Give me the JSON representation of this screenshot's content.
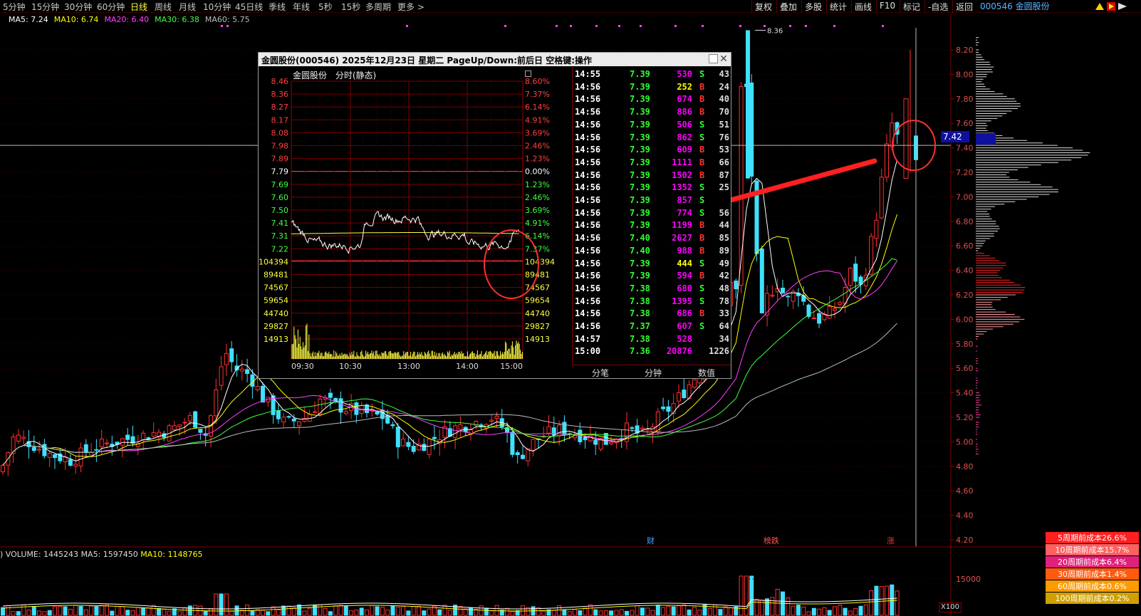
{
  "stock": {
    "code": "000546",
    "name": "金圆股份"
  },
  "periods": [
    "5分钟",
    "15分钟",
    "30分钟",
    "60分钟",
    "日线",
    "周线",
    "月线",
    "10分钟",
    "45日线",
    "季线",
    "年线",
    "5秒",
    "15秒",
    "多周期",
    "更多 >"
  ],
  "active_period": "日线",
  "right_tools": [
    "复权",
    "叠加",
    "多股",
    "统计",
    "画线",
    "F10",
    "标记",
    "-自选",
    "返回"
  ],
  "ma_header": {
    "ma5": "MA5: 7.24",
    "ma10": "MA10: 6.74",
    "ma20": "MA20: 6.40",
    "ma30": "MA30: 6.38",
    "ma60": "MA60: 5.75"
  },
  "price_axis": [
    "8.20",
    "8.00",
    "7.80",
    "7.60",
    "7.40",
    "7.20",
    "7.00",
    "6.80",
    "6.60",
    "6.40",
    "6.20",
    "6.00",
    "5.80",
    "5.60",
    "5.40",
    "5.20",
    "5.00",
    "4.80",
    "4.60",
    "4.40",
    "4.20"
  ],
  "high_label": "8.36",
  "current_price": "7.42",
  "event_markers": [
    {
      "text": "财",
      "color": "#4aa8ff"
    },
    {
      "text": "榜跌",
      "color": "#ff5050"
    },
    {
      "text": "涨",
      "color": "#ff3030"
    }
  ],
  "volume_header": {
    "volume": "VOLUME: 1445243",
    "ma5": "MA5: 1597450",
    "ma10": "MA10: 1148765"
  },
  "volume_axis": "15000",
  "volume_scale": "X100",
  "cost_distribution": [
    {
      "label": "5周期前成本26.6%",
      "color": "#ff2020"
    },
    {
      "label": "10周期前成本15.7%",
      "color": "#ff6060"
    },
    {
      "label": "20周期前成本6.4%",
      "color": "#e0207a"
    },
    {
      "label": "30周期前成本1.4%",
      "color": "#ff5a10"
    },
    {
      "label": "60周期前成本0.6%",
      "color": "#ff9a00"
    },
    {
      "label": "100周期前成本0.2%",
      "color": "#d0a000"
    }
  ],
  "popup": {
    "title": "金圆股份(000546)  2025年12月23日  星期二  PageUp/Down:前后日  空格键:操作",
    "subtitle_name": "金圆股份",
    "subtitle_mode": "分时(静态)",
    "price_labels": [
      "8.46",
      "8.36",
      "8.27",
      "8.17",
      "8.08",
      "7.98",
      "7.89",
      "7.79",
      "7.69",
      "7.60",
      "7.50",
      "7.41",
      "7.31",
      "7.22"
    ],
    "pct_labels": [
      "8.60%",
      "7.37%",
      "6.14%",
      "4.91%",
      "3.69%",
      "2.46%",
      "1.23%",
      "0.00%",
      "1.23%",
      "2.46%",
      "3.69%",
      "4.91%",
      "6.14%",
      "7.37%"
    ],
    "vol_labels": [
      "104394",
      "89481",
      "74567",
      "59654",
      "44740",
      "29827",
      "14913"
    ],
    "time_labels": [
      "09:30",
      "10:30",
      "13:00",
      "14:00",
      "15:00"
    ],
    "ticks": [
      {
        "t": "14:55",
        "p": "7.39",
        "v": "530",
        "vc": "M",
        "bs": "S",
        "n": "43"
      },
      {
        "t": "14:56",
        "p": "7.39",
        "v": "252",
        "vc": "Y",
        "bs": "B",
        "n": "24"
      },
      {
        "t": "14:56",
        "p": "7.39",
        "v": "674",
        "vc": "M",
        "bs": "B",
        "n": "40"
      },
      {
        "t": "14:56",
        "p": "7.39",
        "v": "886",
        "vc": "M",
        "bs": "B",
        "n": "70"
      },
      {
        "t": "14:56",
        "p": "7.39",
        "v": "506",
        "vc": "M",
        "bs": "S",
        "n": "51"
      },
      {
        "t": "14:56",
        "p": "7.39",
        "v": "862",
        "vc": "M",
        "bs": "S",
        "n": "76"
      },
      {
        "t": "14:56",
        "p": "7.39",
        "v": "609",
        "vc": "M",
        "bs": "B",
        "n": "53"
      },
      {
        "t": "14:56",
        "p": "7.39",
        "v": "1111",
        "vc": "M",
        "bs": "B",
        "n": "66"
      },
      {
        "t": "14:56",
        "p": "7.39",
        "v": "1502",
        "vc": "M",
        "bs": "B",
        "n": "87"
      },
      {
        "t": "14:56",
        "p": "7.39",
        "v": "1352",
        "vc": "M",
        "bs": "S",
        "n": "25"
      },
      {
        "t": "14:56",
        "p": "7.39",
        "v": "857",
        "vc": "M",
        "bs": "S",
        "n": ""
      },
      {
        "t": "14:56",
        "p": "7.39",
        "v": "774",
        "vc": "M",
        "bs": "S",
        "n": "56"
      },
      {
        "t": "14:56",
        "p": "7.39",
        "v": "1199",
        "vc": "M",
        "bs": "B",
        "n": "44"
      },
      {
        "t": "14:56",
        "p": "7.40",
        "v": "2627",
        "vc": "M",
        "bs": "B",
        "n": "85"
      },
      {
        "t": "14:56",
        "p": "7.40",
        "v": "988",
        "vc": "M",
        "bs": "B",
        "n": "89"
      },
      {
        "t": "14:56",
        "p": "7.39",
        "v": "444",
        "vc": "Y",
        "bs": "S",
        "n": "49"
      },
      {
        "t": "14:56",
        "p": "7.39",
        "v": "594",
        "vc": "M",
        "bs": "B",
        "n": "42"
      },
      {
        "t": "14:56",
        "p": "7.38",
        "v": "680",
        "vc": "M",
        "bs": "S",
        "n": "48"
      },
      {
        "t": "14:56",
        "p": "7.38",
        "v": "1395",
        "vc": "M",
        "bs": "S",
        "n": "78"
      },
      {
        "t": "14:56",
        "p": "7.38",
        "v": "686",
        "vc": "M",
        "bs": "B",
        "n": "33"
      },
      {
        "t": "14:56",
        "p": "7.37",
        "v": "607",
        "vc": "M",
        "bs": "S",
        "n": "64"
      },
      {
        "t": "14:57",
        "p": "7.38",
        "v": "528",
        "vc": "M",
        "bs": "",
        "n": "34"
      },
      {
        "t": "15:00",
        "p": "7.36",
        "v": "20876",
        "vc": "M",
        "bs": "",
        "n": "1226"
      }
    ],
    "tabs": [
      "分笔",
      "分钟",
      "数值"
    ]
  }
}
